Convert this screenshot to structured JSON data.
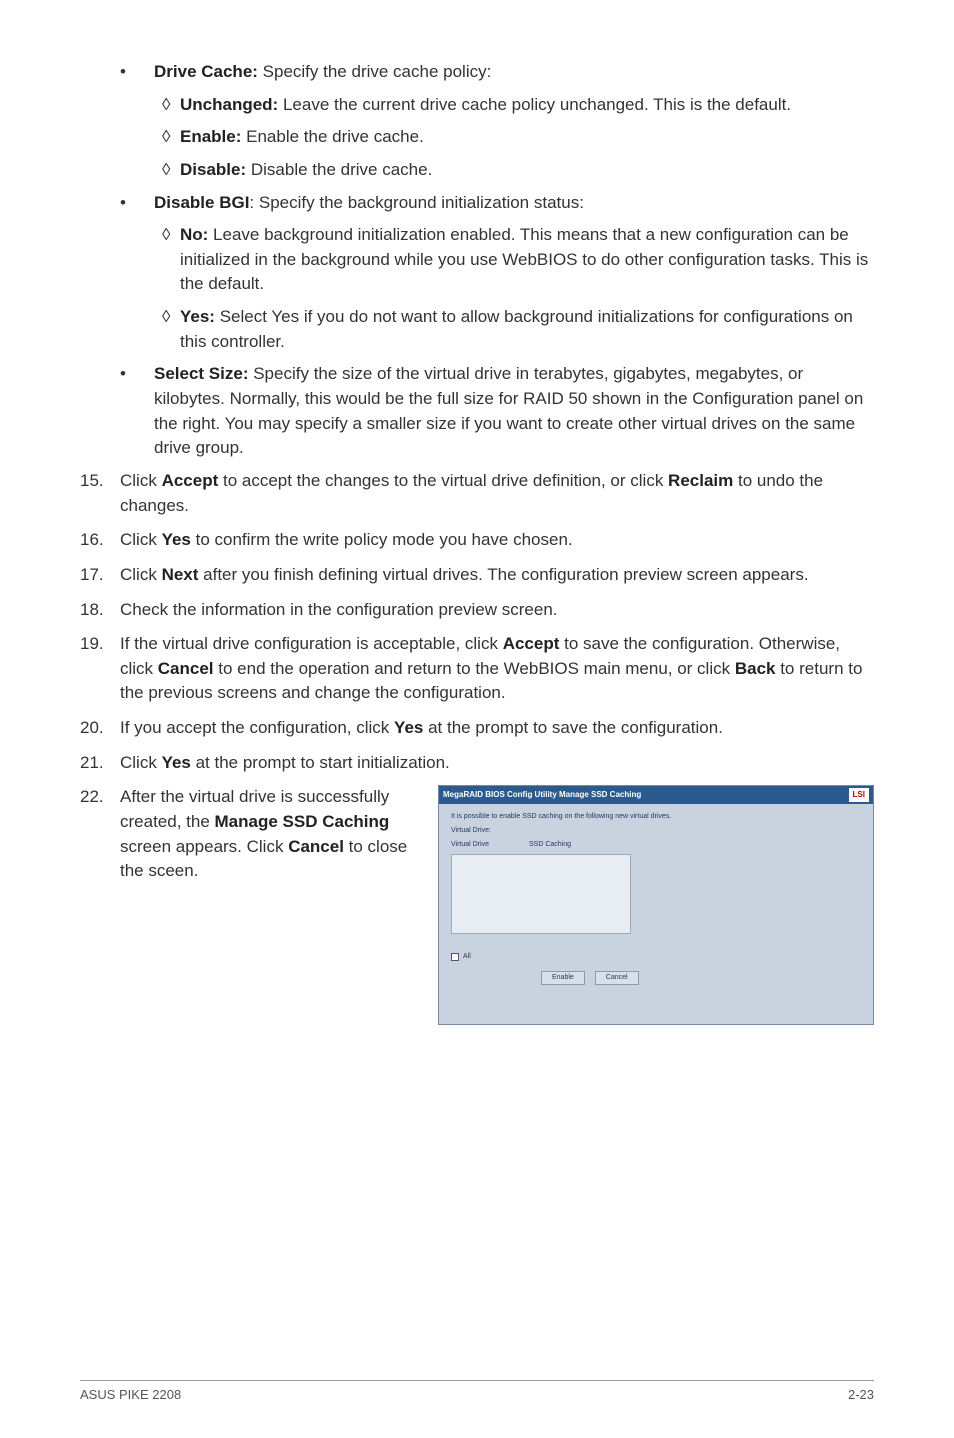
{
  "b1": {
    "lead": "Drive Cache:",
    "rest": " Specify the drive cache policy:",
    "s1lead": "Unchanged:",
    "s1rest": " Leave the current drive cache policy unchanged. This is the default.",
    "s2lead": "Enable:",
    "s2rest": " Enable the drive cache.",
    "s3lead": "Disable:",
    "s3rest": " Disable the drive cache."
  },
  "b2": {
    "lead": "Disable BGI",
    "rest": ": Specify the background initialization status:",
    "s1lead": "No:",
    "s1rest": " Leave background initialization enabled. This means that a new configuration can be initialized in the background while you use WebBIOS to do other configuration tasks. This is the default.",
    "s2lead": "Yes:",
    "s2rest": " Select Yes if you do not want to allow background initializations for configurations on this controller."
  },
  "b3": {
    "lead": "Select Size:",
    "rest": " Specify the size of the virtual drive in terabytes, gigabytes, megabytes, or kilobytes. Normally, this would be the full size for RAID 50 shown in the Configuration panel on the right. You may specify a smaller size if you want to create other virtual drives on the same drive group."
  },
  "n15": {
    "num": "15.",
    "a": "Click ",
    "b1": "Accept",
    "c": " to accept the changes to the virtual drive definition, or click ",
    "b2": "Reclaim",
    "d": " to undo the changes."
  },
  "n16": {
    "num": "16.",
    "a": "Click ",
    "b1": "Yes",
    "c": " to confirm the write policy mode you have chosen."
  },
  "n17": {
    "num": "17.",
    "a": "Click ",
    "b1": "Next",
    "c": " after you finish defining virtual drives. The configuration preview screen appears."
  },
  "n18": {
    "num": "18.",
    "a": "Check the information in the configuration preview screen."
  },
  "n19": {
    "num": "19.",
    "a": "If the virtual drive configuration is acceptable, click ",
    "b1": "Accept",
    "c": " to save the configuration. Otherwise, click ",
    "b2": "Cancel",
    "d": " to end the operation and return to the WebBIOS main menu, or click ",
    "b3": "Back",
    "e": " to return to the previous screens and change the configuration."
  },
  "n20": {
    "num": "20.",
    "a": "If you accept the configuration, click ",
    "b1": "Yes",
    "c": " at the prompt to save the configuration."
  },
  "n21": {
    "num": "21.",
    "a": "Click ",
    "b1": "Yes",
    "c": " at the prompt to start initialization."
  },
  "n22": {
    "num": "22.",
    "a": "After the virtual drive is successfully created, the ",
    "b1": "Manage SSD Caching",
    "c": " screen appears. Click ",
    "b2": "Cancel",
    "d": " to close the sceen."
  },
  "mini": {
    "title": "MegaRAID BIOS Config Utility Manage SSD Caching",
    "lsi": "LSI",
    "msg": "It is possible to enable SSD caching on the following new virtual drives.",
    "col1": "Virtual Drive:",
    "col2": "SSD Caching",
    "vd": "Virtual Drive",
    "all": "All",
    "enable": "Enable",
    "cancel": "Cancel"
  },
  "footer": {
    "left": "ASUS PIKE 2208",
    "right": "2-23"
  }
}
